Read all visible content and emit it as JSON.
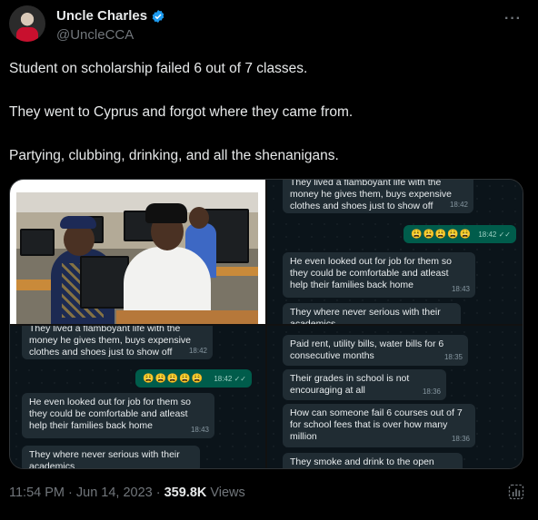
{
  "author": {
    "display_name": "Uncle Charles",
    "handle": "@UncleCCA",
    "verified": true,
    "verified_color": "#1d9bf0"
  },
  "tweet": {
    "paragraphs": [
      "Student on scholarship failed 6 out of 7 classes.",
      "They went to Cyprus and forgot where they came from.",
      "Partying, clubbing, drinking, and all the shenanigans."
    ]
  },
  "media": {
    "chat_a": {
      "msg1": "They lived a flamboyant life with the money he gives them,  buys expensive clothes and shoes just to show off",
      "msg1_time": "18:42",
      "msg2_emojis": "😩😩😩😩😩",
      "msg2_time": "18:42 ✓✓",
      "msg3": "He even looked out for job for them so they could be  comfortable and atleast help their families back home",
      "msg3_time": "18:43",
      "msg4": "They where never serious with their academics"
    },
    "chat_b": {
      "msg1": "They lived a flamboyant life with the money he gives them,  buys expensive clothes and shoes just to show off",
      "msg1_time": "18:42",
      "msg2_emojis": "😩😩😩😩😩",
      "msg2_time": "18:42 ✓✓",
      "msg3": "He even looked out for job for them so they could be  comfortable and atleast help their families back home",
      "msg3_time": "18:43",
      "msg4": "They where never serious with their academics"
    },
    "chat_c": {
      "msg1": "Paid rent, utility bills, water bills for 6 consecutive months",
      "msg1_time": "18:35",
      "msg2": "Their grades in school is not encouraging at all",
      "msg2_time": "18:36",
      "msg3": "How can someone fail 6 courses out of 7 for school fees that is over how many million",
      "msg3_time": "18:36",
      "msg4": "They smoke and drink to the open"
    }
  },
  "footer": {
    "time": "11:54 PM · Jun 14, 2023 · ",
    "views_count": "359.8K",
    "views_label": "Views"
  },
  "icons": {
    "more": "more-icon",
    "stats": "stats-icon"
  }
}
